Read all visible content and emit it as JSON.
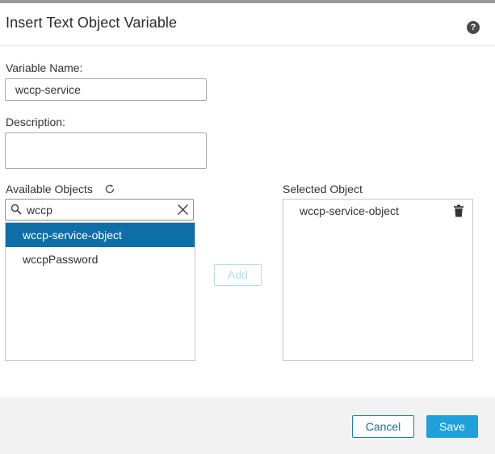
{
  "dialog": {
    "title": "Insert Text Object Variable",
    "help_icon": "question-circle-icon",
    "help_glyph": "?"
  },
  "form": {
    "variable_name_label": "Variable Name:",
    "variable_name_value": "wccp-service",
    "description_label": "Description:",
    "description_value": ""
  },
  "available": {
    "label": "Available Objects",
    "refresh_icon": "refresh-icon",
    "search": {
      "value": "wccp",
      "placeholder": "",
      "search_icon": "search-icon",
      "clear_icon": "close-icon"
    },
    "items": [
      {
        "label": "wccp-service-object",
        "selected": true
      },
      {
        "label": "wccpPassword",
        "selected": false
      }
    ]
  },
  "add_button": {
    "label": "Add",
    "disabled": true
  },
  "selected": {
    "label": "Selected Object",
    "items": [
      {
        "label": "wccp-service-object",
        "icon": "trash-icon"
      }
    ]
  },
  "footer": {
    "cancel_label": "Cancel",
    "save_label": "Save"
  },
  "colors": {
    "accent": "#1ea0dd",
    "selected_row": "#0e6ea8",
    "footer_bg": "#f2f2f2",
    "disabled_button": "#b7dcf0"
  }
}
